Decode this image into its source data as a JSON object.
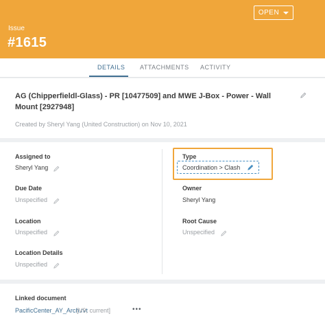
{
  "header": {
    "status_button": "OPEN",
    "label": "Issue",
    "number": "#1615",
    "colors": {
      "header_bg": "#f0a63a",
      "accent": "#3f6e91"
    }
  },
  "tabs": [
    {
      "label": "DETAILS",
      "active": true
    },
    {
      "label": "ATTACHMENTS",
      "active": false
    },
    {
      "label": "ACTIVITY",
      "active": false
    }
  ],
  "title_card": {
    "title": "AG (Chipperfieldl-Glass) - PR [10477509] and MWE J-Box - Power - Wall Mount [2927948]",
    "created": "Created by Sheryl Yang (United Construction) on Nov 10, 2021"
  },
  "fields": {
    "assigned_to": {
      "label": "Assigned to",
      "value": "Sheryl Yang"
    },
    "type": {
      "label": "Type",
      "value": "Coordination > Clash"
    },
    "due_date": {
      "label": "Due Date",
      "value": "Unspecified"
    },
    "owner": {
      "label": "Owner",
      "value": "Sheryl Yang"
    },
    "location": {
      "label": "Location",
      "value": "Unspecified"
    },
    "root_cause": {
      "label": "Root Cause",
      "value": "Unspecified"
    },
    "location_details": {
      "label": "Location Details",
      "value": "Unspecified"
    }
  },
  "linked": {
    "label": "Linked document",
    "doc_name": "PacificCenter_AY_Arch.rvt",
    "doc_meta": "[V9, current]",
    "more": "•••"
  },
  "icons": [
    "caret-down-icon",
    "pencil-icon",
    "more-icon"
  ]
}
